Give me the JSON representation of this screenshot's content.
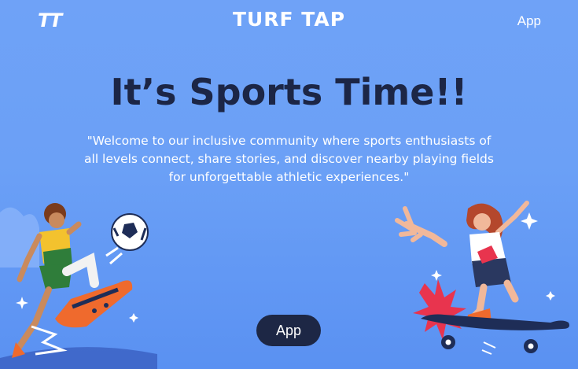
{
  "header": {
    "logo_text": "TT",
    "brand": "TURF TAP",
    "nav_app_label": "App"
  },
  "hero": {
    "headline": "It’s Sports Time!!",
    "tagline": "\"Welcome to our inclusive community where sports enthusiasts of all levels connect, share stories, and discover nearby playing fields for unforgettable athletic experiences.\"",
    "cta_label": "App"
  },
  "illustrations": {
    "left": "soccer-player-kicking-ball",
    "right": "skateboarder-girl"
  },
  "colors": {
    "background": "#6ba0f6",
    "headline": "#1c2646",
    "button": "#1d2745",
    "accent_red": "#e8344e",
    "text_light": "#ffffff"
  }
}
